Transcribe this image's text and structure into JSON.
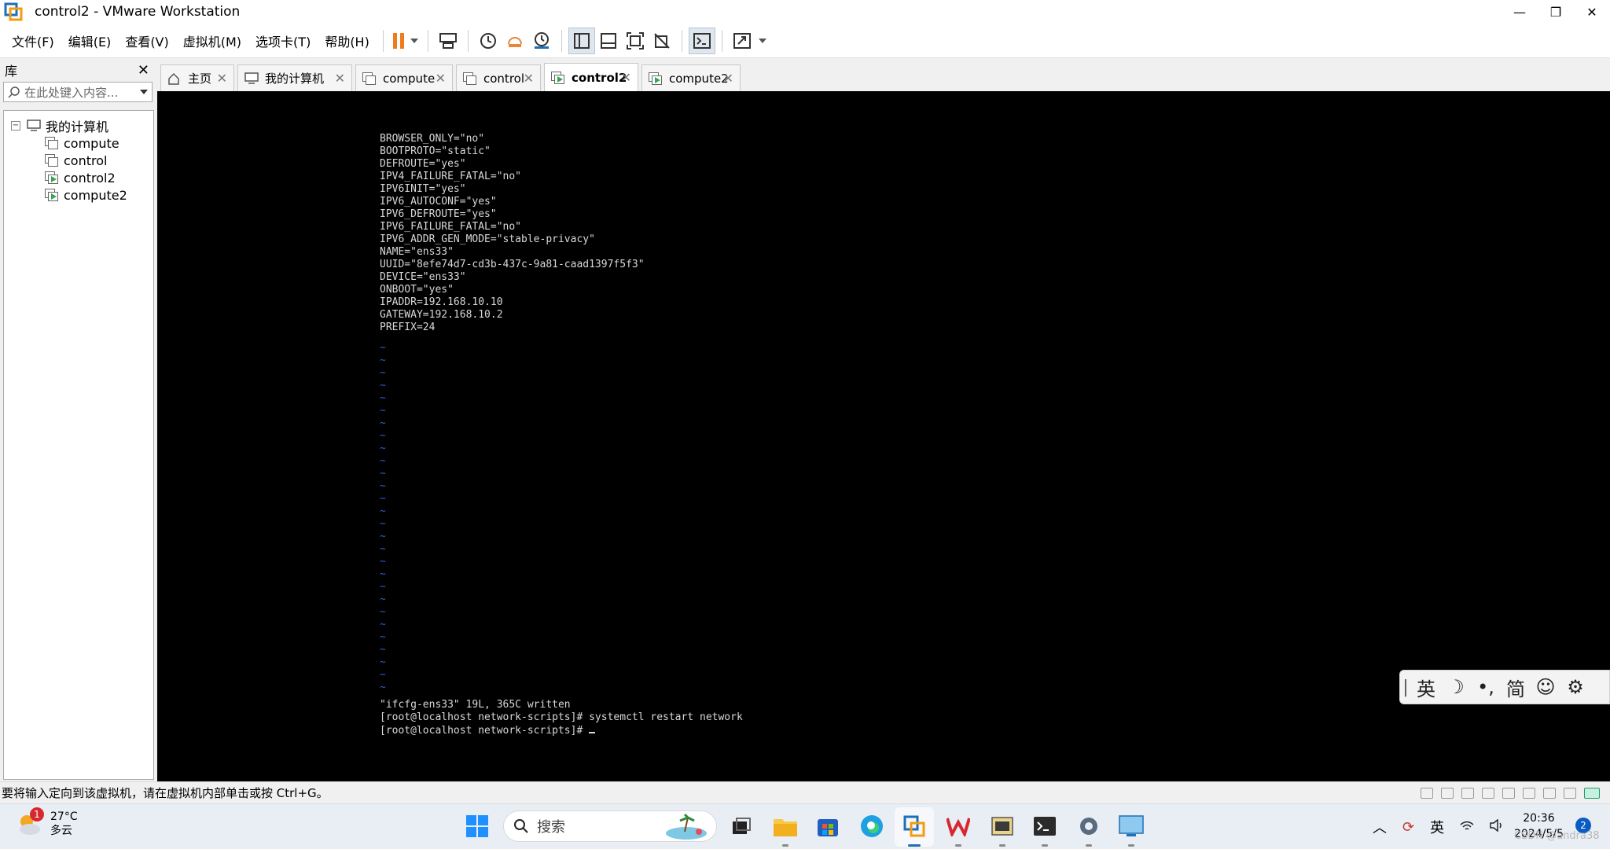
{
  "window": {
    "title": "control2 - VMware Workstation",
    "controls": [
      "—",
      "❐",
      "✕"
    ]
  },
  "menu": [
    "文件(F)",
    "编辑(E)",
    "查看(V)",
    "虚拟机(M)",
    "选项卡(T)",
    "帮助(H)"
  ],
  "library": {
    "title": "库",
    "search_placeholder": "在此处键入内容...",
    "root": "我的计算机",
    "vms": [
      {
        "name": "compute",
        "running": false
      },
      {
        "name": "control",
        "running": false
      },
      {
        "name": "control2",
        "running": true
      },
      {
        "name": "compute2",
        "running": true
      }
    ]
  },
  "tabs": [
    {
      "label": "主页",
      "icon": "home-icon"
    },
    {
      "label": "我的计算机",
      "icon": "computer-icon"
    },
    {
      "label": "compute",
      "icon": "vm-icon"
    },
    {
      "label": "control",
      "icon": "vm-icon"
    },
    {
      "label": "control2",
      "icon": "vm-running-icon",
      "active": true
    },
    {
      "label": "compute2",
      "icon": "vm-running-icon"
    }
  ],
  "terminal": {
    "config_lines": [
      "BROWSER_ONLY=\"no\"",
      "BOOTPROTO=\"static\"",
      "DEFROUTE=\"yes\"",
      "IPV4_FAILURE_FATAL=\"no\"",
      "IPV6INIT=\"yes\"",
      "IPV6_AUTOCONF=\"yes\"",
      "IPV6_DEFROUTE=\"yes\"",
      "IPV6_FAILURE_FATAL=\"no\"",
      "IPV6_ADDR_GEN_MODE=\"stable-privacy\"",
      "NAME=\"ens33\"",
      "UUID=\"8efe74d7-cd3b-437c-9a81-caad1397f5f3\"",
      "DEVICE=\"ens33\"",
      "ONBOOT=\"yes\"",
      "IPADDR=192.168.10.10",
      "GATEWAY=192.168.10.2",
      "PREFIX=24"
    ],
    "tilde_count": 28,
    "tilde": "~",
    "status_line": "\"ifcfg-ens33\" 19L, 365C written",
    "prompt_line_1": "[root@localhost network-scripts]# systemctl restart network",
    "prompt_line_2": "[root@localhost network-scripts]# "
  },
  "ime": {
    "items": [
      "英",
      "☽",
      "•,",
      "简",
      "☺",
      "⚙"
    ]
  },
  "status": {
    "message": "要将输入定向到该虚拟机，请在虚拟机内部单击或按 Ctrl+G。"
  },
  "taskbar": {
    "weather_badge": "1",
    "temperature": "27°C",
    "condition": "多云",
    "search_label": "搜索",
    "tray_lang": "英",
    "time": "20:36",
    "date": "2024/5/5",
    "notification_count": "2"
  },
  "watermark": "CSDN @andra38"
}
